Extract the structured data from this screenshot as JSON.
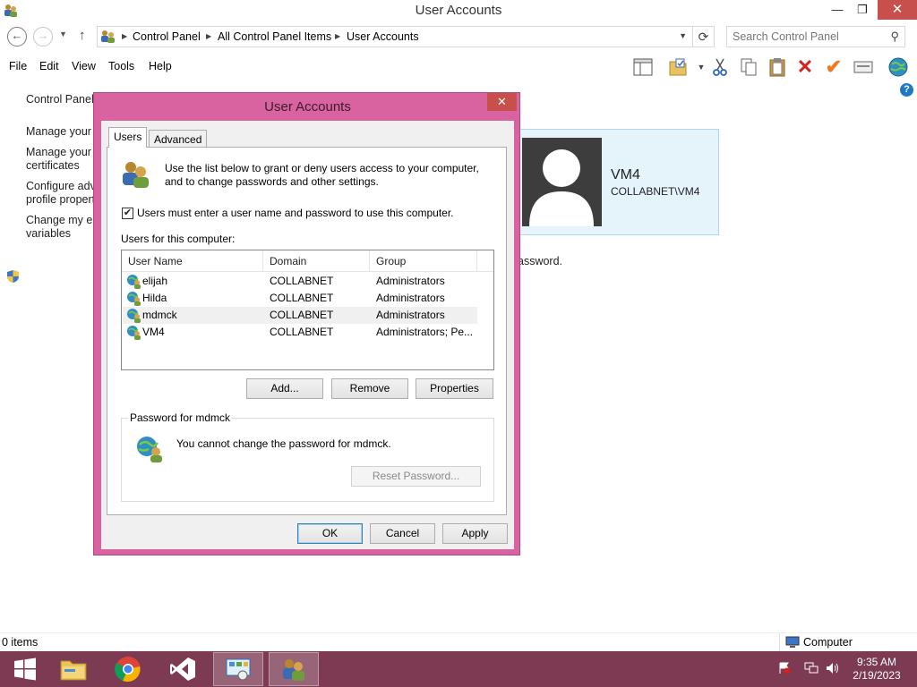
{
  "window": {
    "title": "User Accounts",
    "min": "—",
    "max": "❐",
    "close": "✕"
  },
  "nav": {
    "back": "←",
    "forward": "→",
    "recent": "▼",
    "up": "↑",
    "refresh": "⟳"
  },
  "address": {
    "crumbs": [
      "Control Panel",
      "All Control Panel Items",
      "User Accounts"
    ],
    "sep": "▶",
    "dropdown": "▼"
  },
  "search": {
    "placeholder": "Search Control Panel",
    "icon": "⚲"
  },
  "menu": [
    "File",
    "Edit",
    "View",
    "Tools",
    "Help"
  ],
  "help_glyph": "?",
  "left_pane": {
    "links": [
      [
        "Control Panel"
      ],
      [
        "Manage your c"
      ],
      [
        "Manage your f",
        "certificates"
      ],
      [
        "Configure adv",
        "profile propert"
      ],
      [
        "Change my en",
        "variables"
      ]
    ]
  },
  "user_card": {
    "name": "VM4",
    "domain": "COLLABNET\\VM4"
  },
  "behind_text": "assword.",
  "status": {
    "items": "0 items",
    "zone": "Computer"
  },
  "clock": {
    "time": "9:35 AM",
    "date": "2/19/2023"
  },
  "dialog": {
    "title": "User Accounts",
    "close": "✕",
    "tabs": [
      "Users",
      "Advanced"
    ],
    "intro": "Use the list below to grant or deny users access to your computer, and to change passwords and other settings.",
    "checkbox_label": "Users must enter a user name and password to use this computer.",
    "checkbox_checked": true,
    "check_glyph": "✔",
    "users_label": "Users for this computer:",
    "columns": [
      "User Name",
      "Domain",
      "Group"
    ],
    "users": [
      {
        "name": "elijah",
        "domain": "COLLABNET",
        "group": "Administrators"
      },
      {
        "name": "Hilda",
        "domain": "COLLABNET",
        "group": "Administrators"
      },
      {
        "name": "mdmck",
        "domain": "COLLABNET",
        "group": "Administrators"
      },
      {
        "name": "VM4",
        "domain": "COLLABNET",
        "group": "Administrators; Pe..."
      }
    ],
    "buttons": {
      "add": "Add...",
      "remove": "Remove",
      "properties": "Properties"
    },
    "password_group": {
      "legend": "Password for mdmck",
      "message": "You cannot change the password for mdmck.",
      "reset": "Reset Password..."
    },
    "footer": {
      "ok": "OK",
      "cancel": "Cancel",
      "apply": "Apply"
    }
  },
  "colors": {
    "dialog_border": "#d962a0",
    "taskbar": "#7c3a53",
    "card_bg": "#e5f3fb"
  }
}
